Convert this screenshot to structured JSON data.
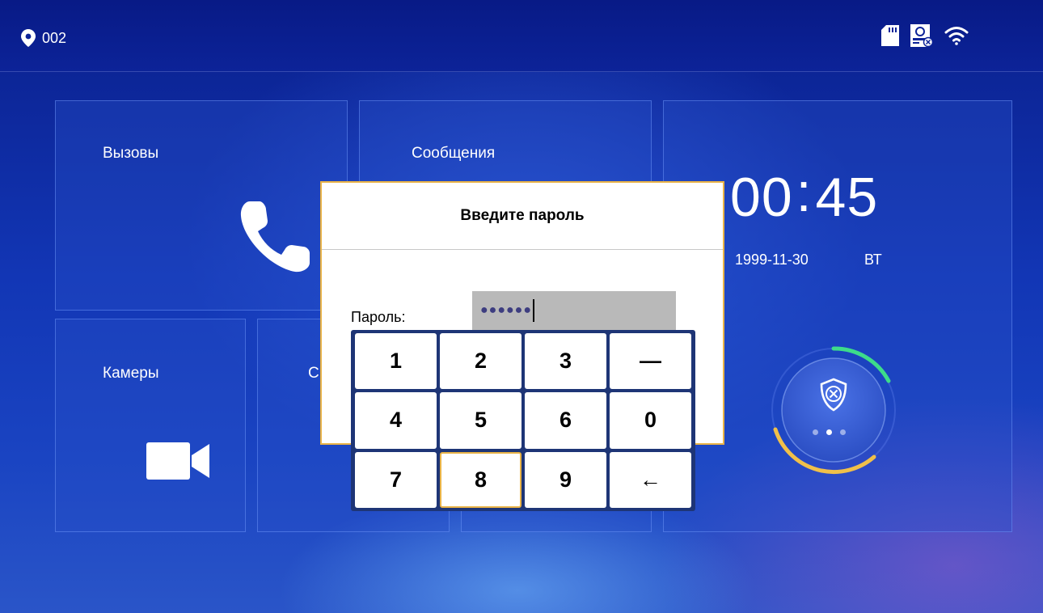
{
  "status_bar": {
    "location": "002",
    "icons": [
      "location-pin-icon",
      "sd-card-icon",
      "user-card-icon",
      "wifi-icon"
    ]
  },
  "tiles": {
    "calls": {
      "label": "Вызовы",
      "icon": "phone-icon"
    },
    "messages": {
      "label": "Сообщения"
    },
    "cameras": {
      "label": "Камеры",
      "icon": "video-camera-icon"
    },
    "partial_label": "С"
  },
  "clock": {
    "time_hh": "00",
    "time_mm": "45",
    "date": "1999-11-30",
    "weekday": "ВТ"
  },
  "security": {
    "icon": "shield-x-icon",
    "page_dots": 3,
    "active_dot": 2
  },
  "dialog": {
    "title": "Введите пароль",
    "password_label": "Пароль:",
    "password_masked": "●●●●●●"
  },
  "keypad": {
    "keys": [
      "1",
      "2",
      "3",
      "—",
      "4",
      "5",
      "6",
      "0",
      "7",
      "8",
      "9",
      "←"
    ],
    "active_key": "8"
  },
  "colors": {
    "accent_border": "#e9b347",
    "keypad_frame": "#1e3576",
    "ring_green": "#3ddc8a",
    "ring_yellow": "#f0c04a"
  }
}
